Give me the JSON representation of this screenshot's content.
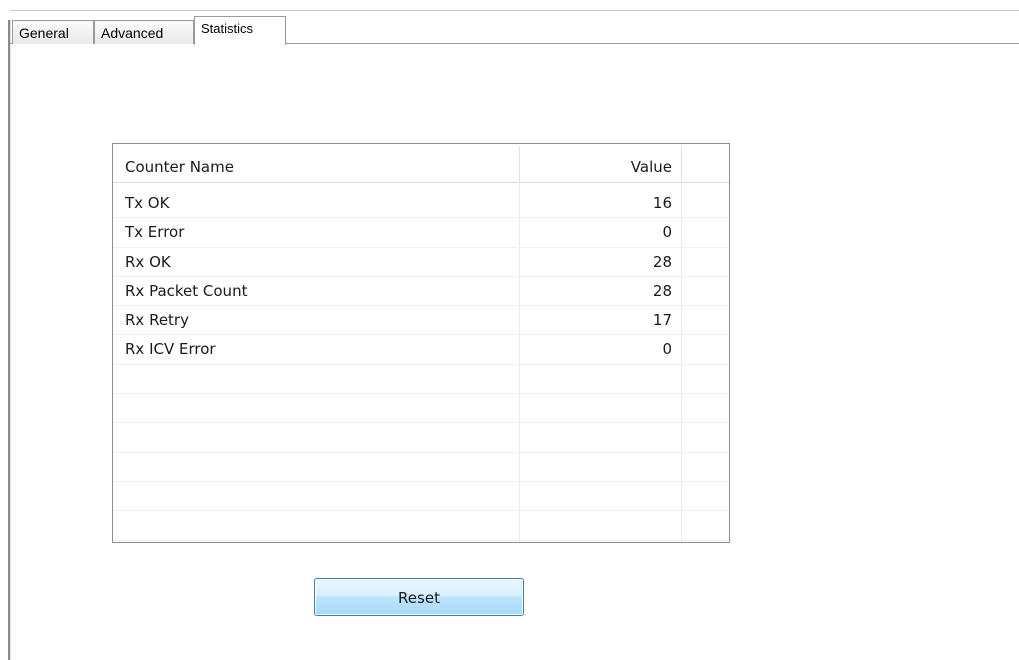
{
  "tabs": [
    {
      "label": "General"
    },
    {
      "label": "Advanced"
    },
    {
      "label": "Statistics"
    }
  ],
  "active_tab": "Statistics",
  "counters_table": {
    "columns": [
      "Counter Name",
      "Value"
    ],
    "rows": [
      {
        "name": "Tx OK",
        "value": "16"
      },
      {
        "name": "Tx Error",
        "value": "0"
      },
      {
        "name": "Rx OK",
        "value": "28"
      },
      {
        "name": "Rx Packet Count",
        "value": "28"
      },
      {
        "name": "Rx Retry",
        "value": "17"
      },
      {
        "name": "Rx ICV Error",
        "value": "0"
      },
      {
        "name": "",
        "value": ""
      },
      {
        "name": "",
        "value": ""
      },
      {
        "name": "",
        "value": ""
      },
      {
        "name": "",
        "value": ""
      },
      {
        "name": "",
        "value": ""
      },
      {
        "name": "",
        "value": ""
      }
    ]
  },
  "reset_button": {
    "label": "Reset"
  }
}
